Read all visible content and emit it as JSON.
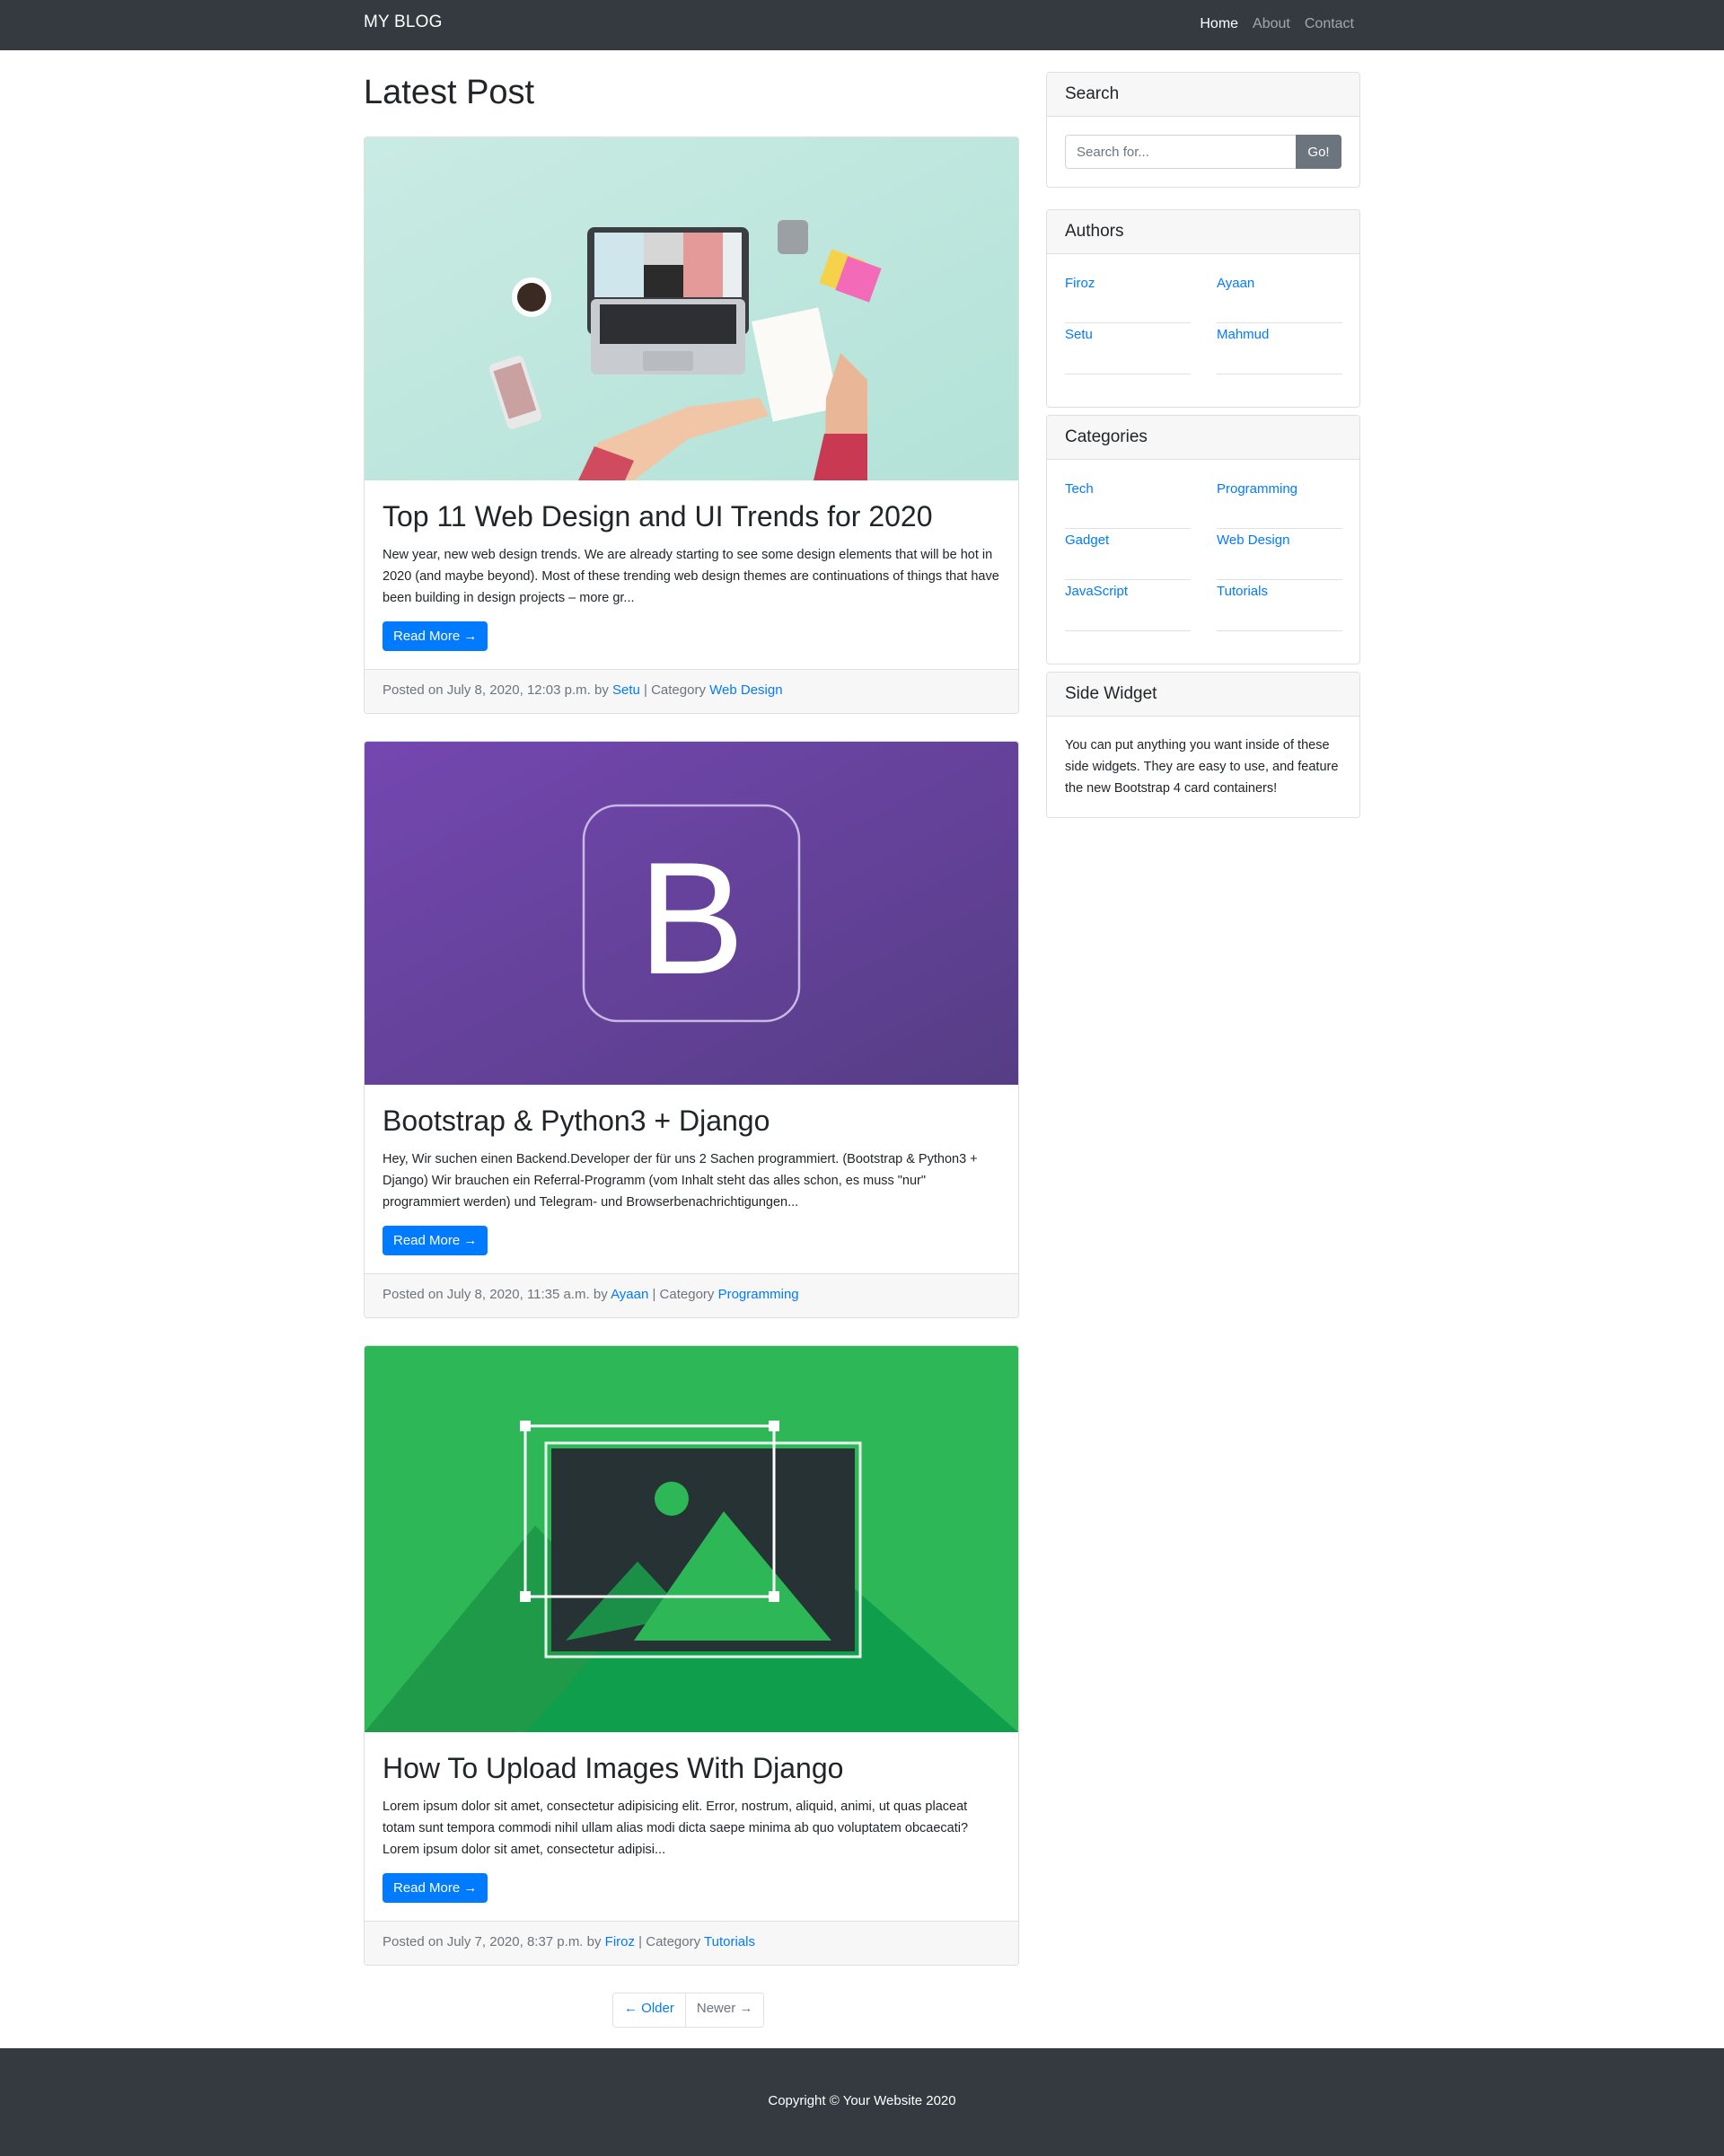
{
  "nav": {
    "brand": "MY BLOG",
    "links": [
      "Home",
      "About",
      "Contact"
    ]
  },
  "main": {
    "page_title": "Latest Post",
    "read_more_label": "Read More →",
    "posts": [
      {
        "title": "Top 11 Web Design and UI Trends for 2020",
        "excerpt": "New year, new web design trends. We are already starting to see some design elements that will be hot in 2020 (and maybe beyond). Most of these trending web design themes are continuations of things that have been building in design projects – more gr...",
        "meta_posted": "Posted on July 8, 2020, 12:03 p.m. by ",
        "author": "Setu",
        "meta_category": " | Category ",
        "category": "Web Design"
      },
      {
        "title": "Bootstrap & Python3 + Django",
        "excerpt": "Hey, Wir suchen einen Backend.Developer der für uns 2 Sachen programmiert. (Bootstrap & Python3 + Django) Wir brauchen ein Referral-Programm (vom Inhalt steht das alles schon, es muss \"nur\" programmiert werden) und Telegram- und Browserbenachrichtigungen...",
        "meta_posted": "Posted on July 8, 2020, 11:35 a.m. by ",
        "author": "Ayaan",
        "meta_category": " | Category ",
        "category": "Programming"
      },
      {
        "title": "How To Upload Images With Django",
        "excerpt": "Lorem ipsum dolor sit amet, consectetur adipisicing elit. Error, nostrum, aliquid, animi, ut quas placeat totam sunt tempora commodi nihil ullam alias modi dicta saepe minima ab quo voluptatem obcaecati? Lorem ipsum dolor sit amet, consectetur adipisi...",
        "meta_posted": "Posted on July 7, 2020, 8:37 p.m. by ",
        "author": "Firoz",
        "meta_category": " | Category ",
        "category": "Tutorials"
      }
    ],
    "pagination": {
      "older": "← Older",
      "newer": "Newer →"
    }
  },
  "sidebar": {
    "search": {
      "title": "Search",
      "placeholder": "Search for...",
      "button": "Go!"
    },
    "authors": {
      "title": "Authors",
      "items": [
        "Firoz",
        "Ayaan",
        "Setu",
        "Mahmud"
      ]
    },
    "categories": {
      "title": "Categories",
      "items": [
        "Tech",
        "Programming",
        "Gadget",
        "Web Design",
        "JavaScript",
        "Tutorials"
      ]
    },
    "side_widget": {
      "title": "Side Widget",
      "text": "You can put anything you want inside of these side widgets. They are easy to use, and feature the new Bootstrap 4 card containers!"
    }
  },
  "footer": {
    "copyright": "Copyright © Your Website 2020"
  },
  "colors": {
    "navbar": "#343a40",
    "link": "#007bff",
    "primary_button": "#007bff",
    "secondary_button": "#6c757d",
    "bootstrap_purple": "#7952b3",
    "django_green": "#2db757"
  }
}
